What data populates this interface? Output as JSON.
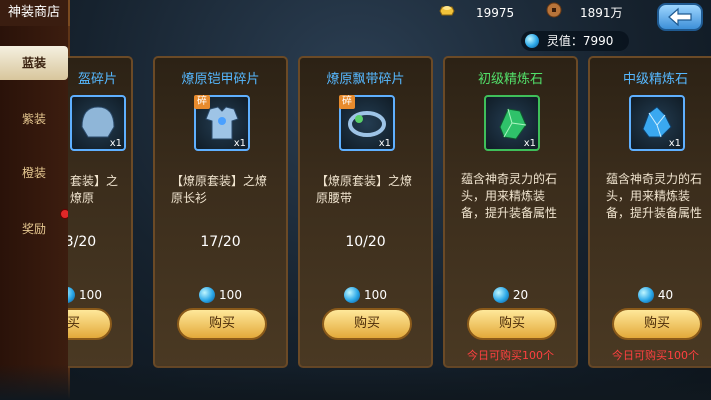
{
  "shop_title": "神装商店",
  "currencies": [
    {
      "icon": "gold-ingot-icon",
      "value": "19975"
    },
    {
      "icon": "copper-coin-icon",
      "value": "1891万"
    }
  ],
  "soul_value": "灵值：7990",
  "tabs": [
    "蓝装",
    "紫装",
    "橙装",
    "奖励"
  ],
  "active_tab": "蓝装",
  "cards": [
    {
      "name": "盔碎片",
      "frag": "",
      "qty": "x1",
      "desc": "套装】之燎原",
      "progress": "3/20",
      "price": "100",
      "buy": "购买",
      "limit": "",
      "color": "blue"
    },
    {
      "name": "燎原铠甲碎片",
      "frag": "碎",
      "qty": "x1",
      "desc": "【燎原套装】之燎原长衫",
      "progress": "17/20",
      "price": "100",
      "buy": "购买",
      "limit": "",
      "color": "blue"
    },
    {
      "name": "燎原飘带碎片",
      "frag": "碎",
      "qty": "x1",
      "desc": "【燎原套装】之燎原腰带",
      "progress": "10/20",
      "price": "100",
      "buy": "购买",
      "limit": "",
      "color": "blue"
    },
    {
      "name": "初级精炼石",
      "frag": "",
      "qty": "x1",
      "desc": "蕴含神奇灵力的石头，用来精炼装备，提升装备属性",
      "progress": "",
      "price": "20",
      "buy": "购买",
      "limit": "今日可购买100个",
      "color": "green"
    },
    {
      "name": "中级精炼石",
      "frag": "",
      "qty": "x1",
      "desc": "蕴含神奇灵力的石头，用来精炼装备，提升装备属性",
      "progress": "",
      "price": "40",
      "buy": "购买",
      "limit": "今日可购买100个",
      "color": "blue"
    }
  ]
}
